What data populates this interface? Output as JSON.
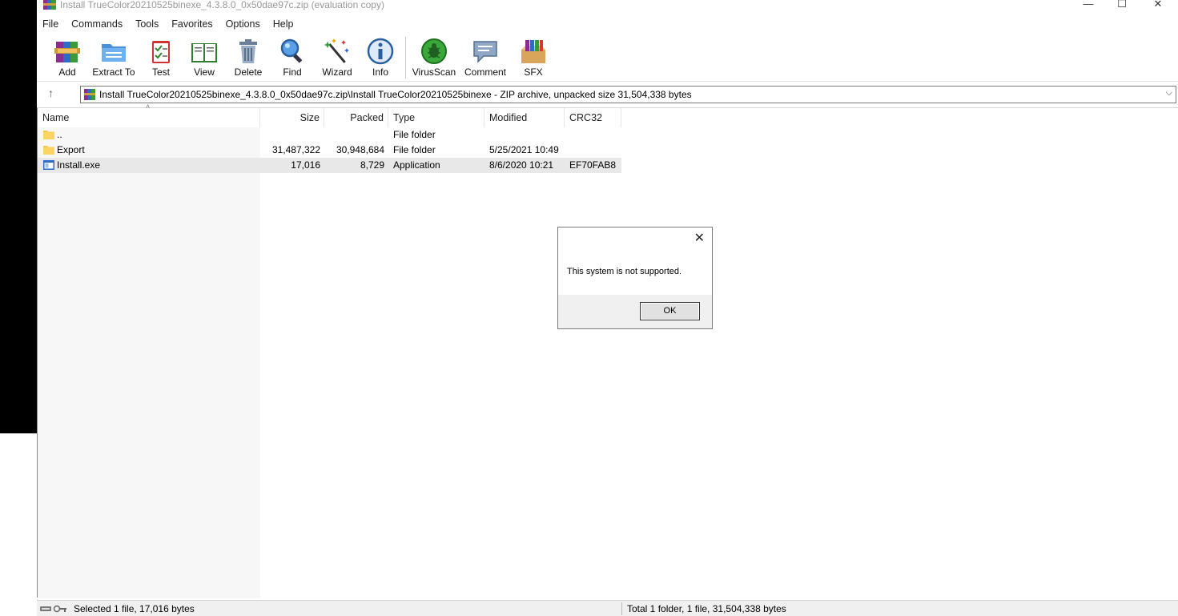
{
  "window": {
    "title": "Install TrueColor20210525binexe_4.3.8.0_0x50dae97c.zip (evaluation copy)",
    "controls": {
      "minimize": "—",
      "maximize": "☐",
      "close": "✕"
    }
  },
  "menu": [
    "File",
    "Commands",
    "Tools",
    "Favorites",
    "Options",
    "Help"
  ],
  "toolbar": [
    {
      "label": "Add",
      "icon": "add-icon"
    },
    {
      "label": "Extract To",
      "icon": "extract-icon"
    },
    {
      "label": "Test",
      "icon": "test-icon"
    },
    {
      "label": "View",
      "icon": "view-icon"
    },
    {
      "label": "Delete",
      "icon": "delete-icon"
    },
    {
      "label": "Find",
      "icon": "find-icon"
    },
    {
      "label": "Wizard",
      "icon": "wizard-icon"
    },
    {
      "label": "Info",
      "icon": "info-icon"
    },
    {
      "label": "VirusScan",
      "icon": "virusscan-icon"
    },
    {
      "label": "Comment",
      "icon": "comment-icon"
    },
    {
      "label": "SFX",
      "icon": "sfx-icon"
    }
  ],
  "address": {
    "up_icon": "↑",
    "text": "Install TrueColor20210525binexe_4.3.8.0_0x50dae97c.zip\\Install TrueColor20210525binexe - ZIP archive, unpacked size 31,504,338 bytes",
    "dropdown_icon": "chevron-down-icon"
  },
  "columns": {
    "name": "Name",
    "size": "Size",
    "packed": "Packed",
    "type": "Type",
    "modified": "Modified",
    "crc": "CRC32"
  },
  "files": [
    {
      "name": "..",
      "size": "",
      "packed": "",
      "type": "File folder",
      "modified": "",
      "crc": "",
      "icon": "folder-icon"
    },
    {
      "name": "Export",
      "size": "31,487,322",
      "packed": "30,948,684",
      "type": "File folder",
      "modified": "5/25/2021 10:49",
      "crc": "",
      "icon": "folder-icon"
    },
    {
      "name": "Install.exe",
      "size": "17,016",
      "packed": "8,729",
      "type": "Application",
      "modified": "8/6/2020 10:21",
      "crc": "EF70FAB8",
      "icon": "application-icon",
      "selected": true
    }
  ],
  "status": {
    "left": "Selected 1 file, 17,016 bytes",
    "right": "Total 1 folder, 1 file, 31,504,338 bytes"
  },
  "dialog": {
    "message": "This system is not supported.",
    "ok_label": "OK",
    "close_icon": "✕"
  },
  "colors": {
    "folder": "#f7c748",
    "selection": "#e8e8e8",
    "dialog_footer": "#f0f0f0"
  }
}
